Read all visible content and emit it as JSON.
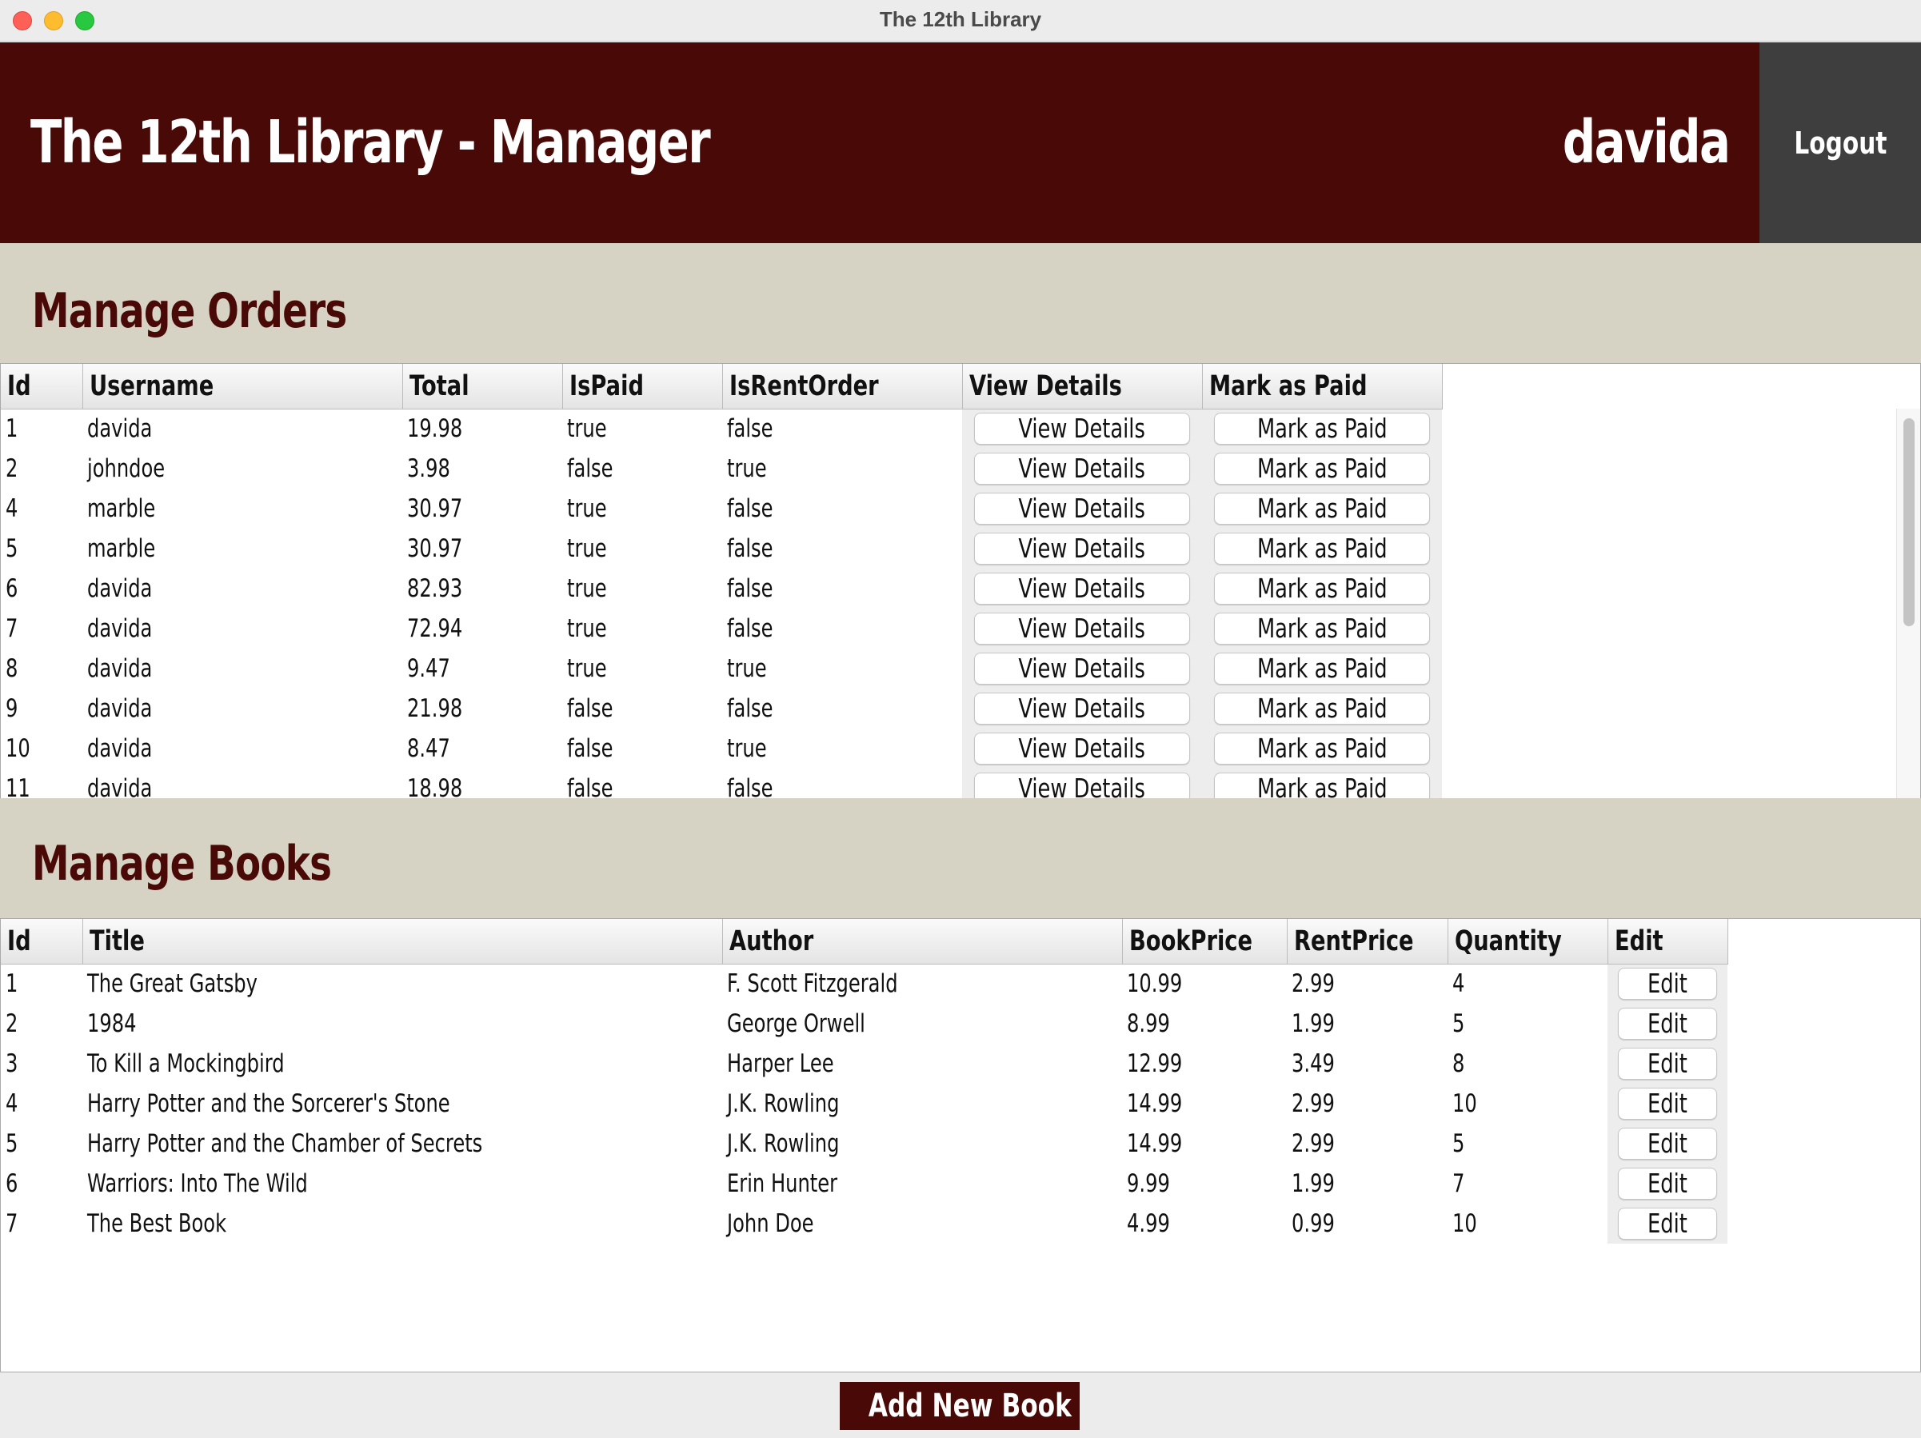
{
  "window": {
    "title": "The 12th Library"
  },
  "header": {
    "title": "The 12th Library - Manager",
    "username": "davida",
    "logout_label": "Logout"
  },
  "orders": {
    "title": "Manage Orders",
    "columns": [
      "Id",
      "Username",
      "Total",
      "IsPaid",
      "IsRentOrder",
      "View Details",
      "Mark as Paid"
    ],
    "view_label": "View Details",
    "paid_label": "Mark as Paid",
    "rows": [
      [
        "1",
        "davida",
        "19.98",
        "true",
        "false"
      ],
      [
        "2",
        "johndoe",
        "3.98",
        "false",
        "true"
      ],
      [
        "4",
        "marble",
        "30.97",
        "true",
        "false"
      ],
      [
        "5",
        "marble",
        "30.97",
        "true",
        "false"
      ],
      [
        "6",
        "davida",
        "82.93",
        "true",
        "false"
      ],
      [
        "7",
        "davida",
        "72.94",
        "true",
        "false"
      ],
      [
        "8",
        "davida",
        "9.47",
        "true",
        "true"
      ],
      [
        "9",
        "davida",
        "21.98",
        "false",
        "false"
      ],
      [
        "10",
        "davida",
        "8.47",
        "false",
        "true"
      ],
      [
        "11",
        "davida",
        "18.98",
        "false",
        "false"
      ]
    ]
  },
  "books": {
    "title": "Manage Books",
    "columns": [
      "Id",
      "Title",
      "Author",
      "BookPrice",
      "RentPrice",
      "Quantity",
      "Edit"
    ],
    "edit_label": "Edit",
    "rows": [
      [
        "1",
        "The Great Gatsby",
        "F. Scott Fitzgerald",
        "10.99",
        "2.99",
        "4"
      ],
      [
        "2",
        "1984",
        "George Orwell",
        "8.99",
        "1.99",
        "5"
      ],
      [
        "3",
        "To Kill a Mockingbird",
        "Harper Lee",
        "12.99",
        "3.49",
        "8"
      ],
      [
        "4",
        "Harry Potter and the Sorcerer's Stone",
        "J.K. Rowling",
        "14.99",
        "2.99",
        "10"
      ],
      [
        "5",
        "Harry Potter and the Chamber of Secrets",
        "J.K. Rowling",
        "14.99",
        "2.99",
        "5"
      ],
      [
        "6",
        "Warriors: Into The Wild",
        "Erin Hunter",
        "9.99",
        "1.99",
        "7"
      ],
      [
        "7",
        "The Best Book",
        "John Doe",
        "4.99",
        "0.99",
        "10"
      ]
    ]
  },
  "footer": {
    "add_label": "Add New Book"
  }
}
